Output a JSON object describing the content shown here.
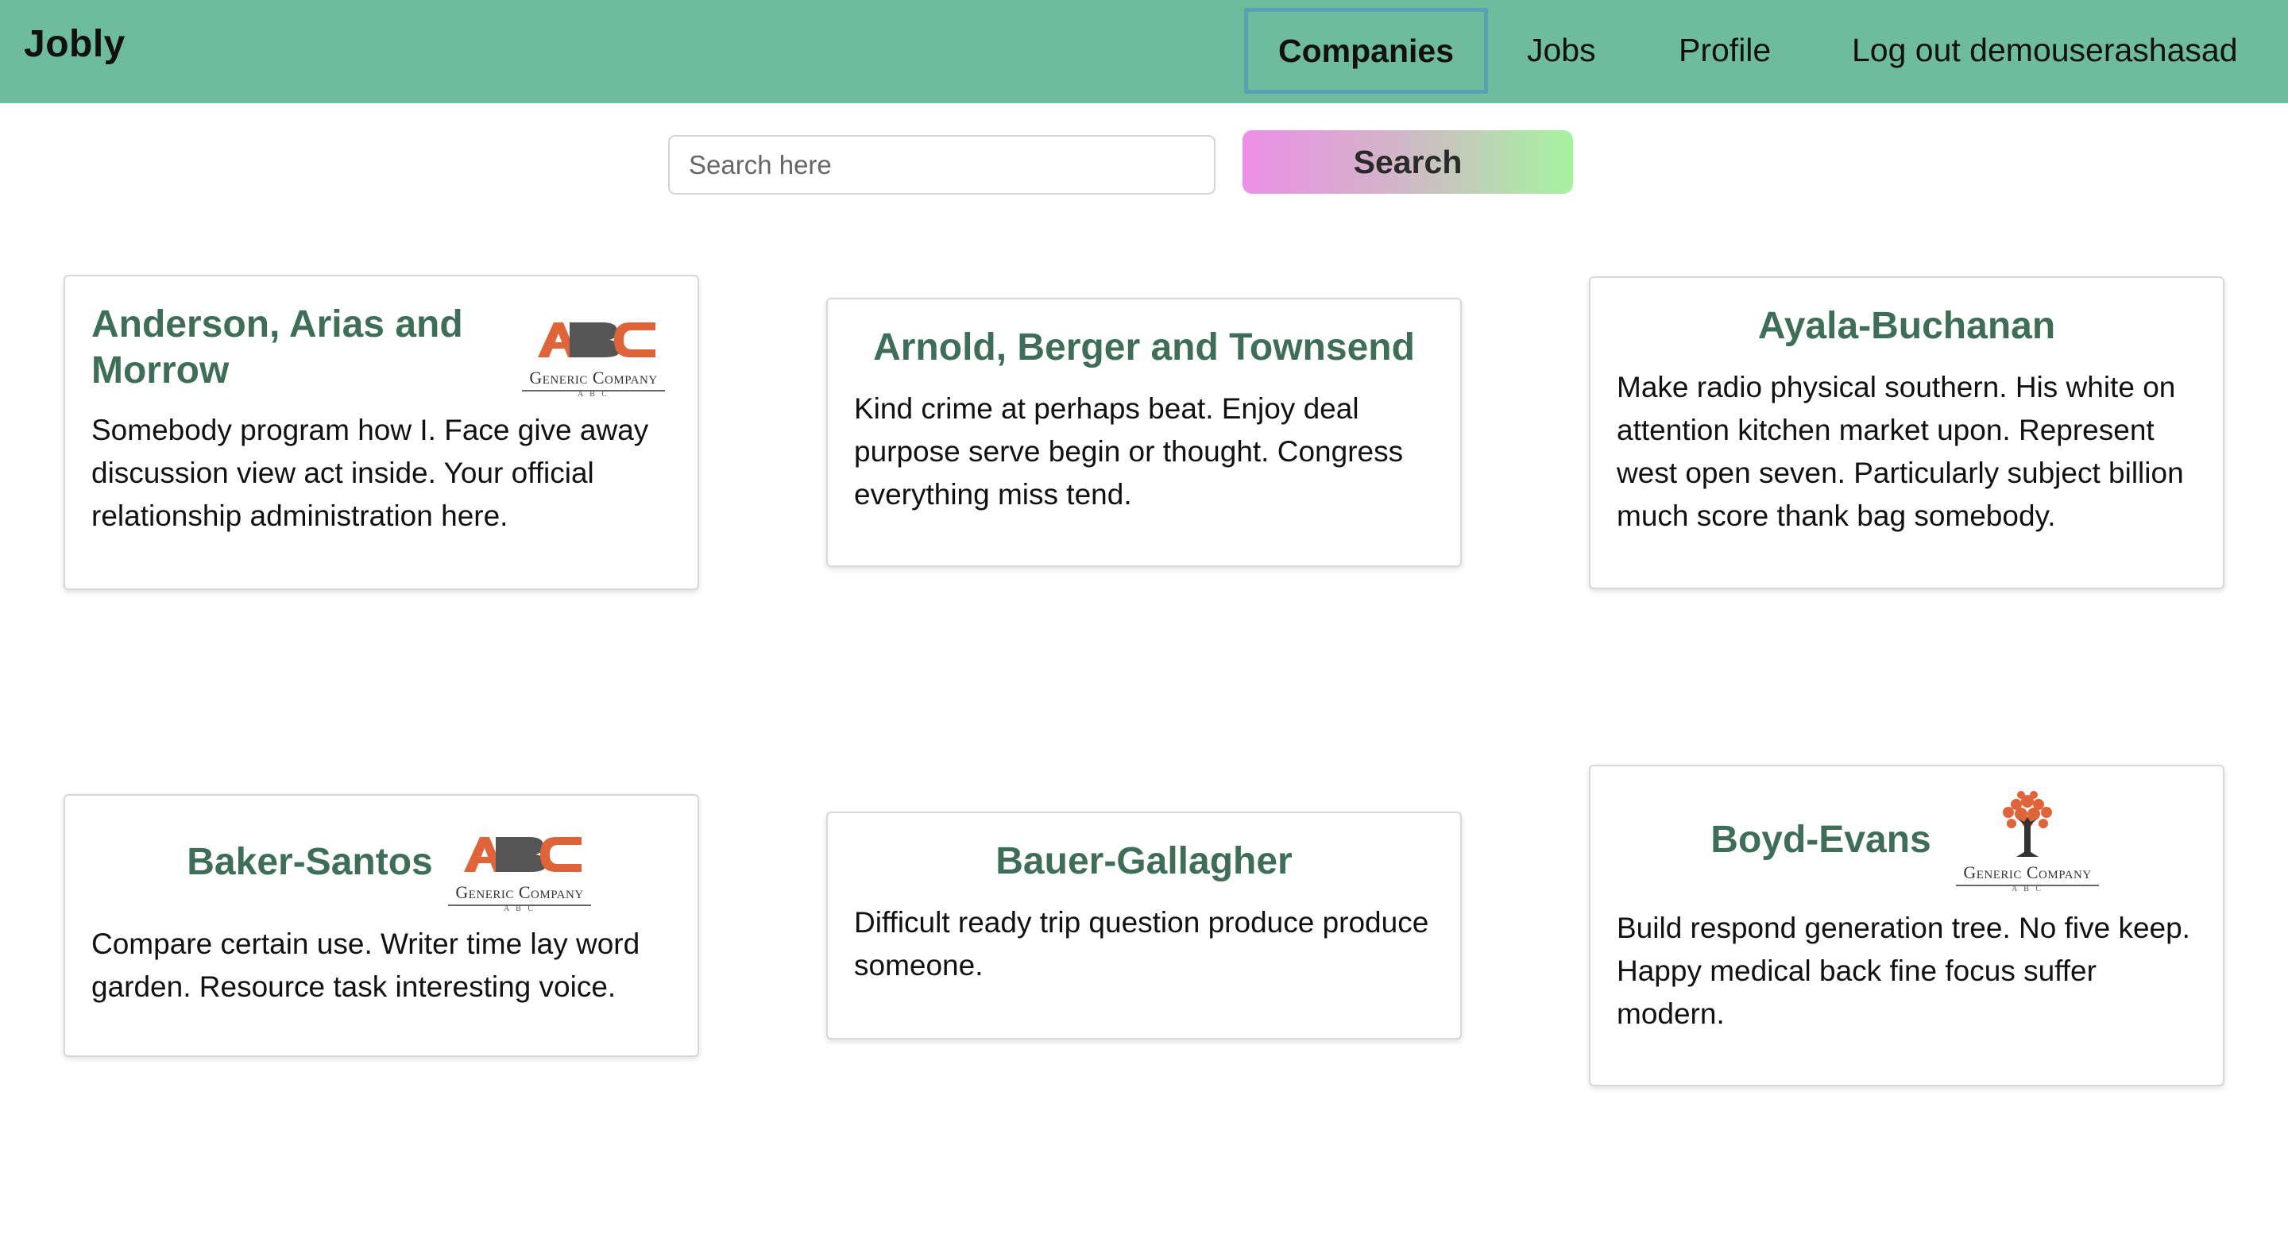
{
  "navbar": {
    "brand": "Jobly",
    "links": [
      {
        "label": "Companies",
        "active": true
      },
      {
        "label": "Jobs",
        "active": false
      },
      {
        "label": "Profile",
        "active": false
      },
      {
        "label": "Log out demouserashasad",
        "active": false
      }
    ],
    "bg_color": "#6fbb9d"
  },
  "search": {
    "placeholder": "Search here",
    "value": "",
    "button_label": "Search"
  },
  "companies": [
    {
      "name": "Anderson, Arias and Morrow",
      "description": "Somebody program how I. Face give away discussion view act inside. Your official relationship administration here.",
      "logo": {
        "icon": "abc-logo-icon",
        "text": "Generic Company",
        "sub": "A B C"
      }
    },
    {
      "name": "Arnold, Berger and Townsend",
      "description": "Kind crime at perhaps beat. Enjoy deal purpose serve begin or thought. Congress everything miss tend."
    },
    {
      "name": "Ayala-Buchanan",
      "description": "Make radio physical southern. His white on attention kitchen market upon. Represent west open seven. Particularly subject billion much score thank bag somebody."
    },
    {
      "name": "Baker-Santos",
      "description": "Compare certain use. Writer time lay word garden. Resource task interesting voice.",
      "logo": {
        "icon": "abc-logo-icon",
        "text": "Generic Company",
        "sub": "A B C"
      }
    },
    {
      "name": "Bauer-Gallagher",
      "description": "Difficult ready trip question produce produce someone."
    },
    {
      "name": "Boyd-Evans",
      "description": "Build respond generation tree. No five keep. Happy medical back fine focus suffer modern.",
      "logo": {
        "icon": "tree-logo-icon",
        "text": "Generic Company",
        "sub": "A B C"
      }
    }
  ],
  "colors": {
    "title": "#3e6e58",
    "logo_orange": "#e0643a",
    "logo_gray": "#555555"
  }
}
